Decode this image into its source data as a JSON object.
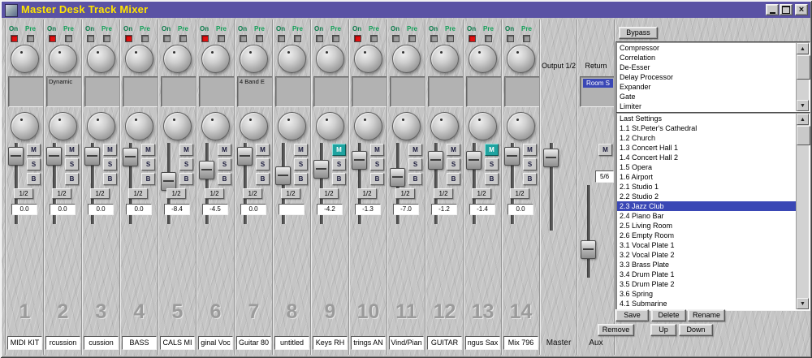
{
  "window": {
    "title": "Master Desk Track Mixer"
  },
  "labels": {
    "on": "On",
    "pre": "Pre",
    "mute": "M",
    "solo": "S",
    "b": "B",
    "route": "1/2"
  },
  "icons": {
    "scroll_up": "▲",
    "scroll_down": "▼",
    "close": "×"
  },
  "channels": [
    {
      "num": "1",
      "name": "MIDI KIT",
      "on": true,
      "insert": "",
      "value": "0.0",
      "fader": 0.06,
      "m_active": false
    },
    {
      "num": "2",
      "name": "rcussion",
      "on": true,
      "insert": "Dynamic",
      "value": "0.0",
      "fader": 0.06,
      "m_active": false
    },
    {
      "num": "3",
      "name": "cussion",
      "on": false,
      "insert": "",
      "value": "0.0",
      "fader": 0.06,
      "m_active": false
    },
    {
      "num": "4",
      "name": "BASS",
      "on": true,
      "insert": "",
      "value": "0.0",
      "fader": 0.08,
      "m_active": false
    },
    {
      "num": "5",
      "name": "CALS MI",
      "on": false,
      "insert": "",
      "value": "-8.4",
      "fader": 0.45,
      "m_active": false
    },
    {
      "num": "6",
      "name": "ginal Voc",
      "on": true,
      "insert": "",
      "value": "-4.5",
      "fader": 0.28,
      "m_active": false
    },
    {
      "num": "7",
      "name": "Guitar 80",
      "on": false,
      "insert": "4 Band E",
      "value": "0.0",
      "fader": 0.06,
      "m_active": false
    },
    {
      "num": "8",
      "name": "untitled",
      "on": false,
      "insert": "",
      "value": "",
      "fader": 0.36,
      "m_active": false
    },
    {
      "num": "9",
      "name": "Keys RH",
      "on": false,
      "insert": "",
      "value": "-4.2",
      "fader": 0.26,
      "m_active": true
    },
    {
      "num": "10",
      "name": "trings AN",
      "on": true,
      "insert": "",
      "value": "-1.3",
      "fader": 0.12,
      "m_active": false
    },
    {
      "num": "11",
      "name": "Vind/Pian",
      "on": false,
      "insert": "",
      "value": "-7.0",
      "fader": 0.39,
      "m_active": false
    },
    {
      "num": "12",
      "name": "GUITAR",
      "on": false,
      "insert": "",
      "value": "-1.2",
      "fader": 0.12,
      "m_active": false
    },
    {
      "num": "13",
      "name": "ngus Sax",
      "on": true,
      "insert": "",
      "value": "-1.4",
      "fader": 0.13,
      "m_active": true
    },
    {
      "num": "14",
      "name": "Mix 796",
      "on": false,
      "insert": "",
      "value": "0.0",
      "fader": 0.06,
      "m_active": false
    }
  ],
  "master": {
    "label": "Output 1/2",
    "name": "Master",
    "fader": 0.08
  },
  "aux": {
    "label": "Return",
    "insert": "Room S",
    "route": "5/6",
    "name": "Aux",
    "fader": 0.72
  },
  "panel": {
    "bypass": "Bypass",
    "effects": [
      "Compressor",
      "Correlation",
      "De-Esser",
      "Delay Processor",
      "Expander",
      "Gate",
      "Limiter"
    ],
    "presets": [
      "Last Settings",
      "1.1 St.Peter's Cathedral",
      "1.2 Church",
      "1.3 Concert Hall 1",
      "1.4 Concert Hall 2",
      "1.5 Opera",
      "1.6 Airport",
      "2.1 Studio 1",
      "2.2 Studio 2",
      "2.3 Jazz Club",
      "2.4 Piano Bar",
      "2.5 Living Room",
      "2.6 Empty Room",
      "3.1 Vocal Plate 1",
      "3.2 Vocal Plate 2",
      "3.3 Brass Plate",
      "3.4 Drum Plate 1",
      "3.5 Drum Plate 2",
      "3.6 Spring",
      "4.1 Submarine"
    ],
    "selected_preset_index": 9,
    "buttons": {
      "save": "Save",
      "delete": "Delete",
      "rename": "Rename",
      "remove": "Remove",
      "up": "Up",
      "down": "Down"
    }
  },
  "colors": {
    "title_purple": "#5a52a4",
    "title_text": "#ffe400",
    "led_red": "#e01010",
    "accent_teal": "#1fa3a0",
    "selection_blue": "#3a47b5"
  }
}
